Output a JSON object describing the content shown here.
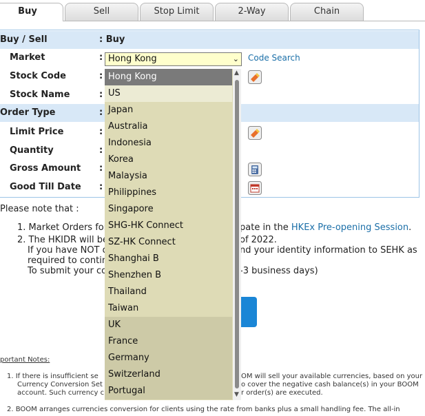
{
  "tabs": [
    {
      "label": "Buy",
      "active": true
    },
    {
      "label": "Sell",
      "active": false
    },
    {
      "label": "Stop Limit",
      "active": false
    },
    {
      "label": "2-Way",
      "active": false
    },
    {
      "label": "Chain",
      "active": false
    }
  ],
  "form": {
    "buy_sell_label": "Buy / Sell",
    "buy_sell_value": ": Buy",
    "market_label": "Market",
    "market_value": "Hong Kong",
    "code_search": "Code Search",
    "stock_code_label": "Stock Code",
    "stock_name_label": "Stock Name",
    "order_type_label": "Order Type",
    "limit_price_label": "Limit Price",
    "quantity_label": "Quantity",
    "gross_amount_label": "Gross Amount",
    "good_till_date_label": "Good Till Date",
    "colon": ":"
  },
  "notes": {
    "please_note": "Please note that :",
    "item1_start": "1. Market Orders for",
    "item1_end": "pate in the",
    "item1_link": "HKEx Pre-opening Session",
    "item1_tail": ".",
    "item2_start": "2. The HKIDR will be",
    "item2_end": "of 2022.",
    "item2_line2a": "If you have NOT d",
    "item2_line2b": "nd your identity information to SEHK as",
    "item2_line3": "required to continu",
    "item2_line4_link": "To submit your co",
    "item2_line4_end": "-3 business days)"
  },
  "important": {
    "title": "portant Notes:",
    "n1_a": "1. If there is insufficient se",
    "n1_b": "OM will sell your available currencies, based on your",
    "n1_link": "Currency Conversion Set",
    "n1_c": "o cover the negative cash balance(s) in your BOOM",
    "n1_d": "account. Such currency c",
    "n1_e": "r order(s) are executed.",
    "n2_a": "2. BOOM arranges currencies conversion for clients using the rate from banks plus a small handling fee. The all-in"
  },
  "market_options": [
    "Hong Kong",
    "US",
    "Japan",
    "Australia",
    "Indonesia",
    "Korea",
    "Malaysia",
    "Philippines",
    "Singapore",
    "SHG-HK Connect",
    "SZ-HK Connect",
    "Shanghai B",
    "Shenzhen B",
    "Thailand",
    "Taiwan",
    "UK",
    "France",
    "Germany",
    "Switzerland",
    "Portugal"
  ],
  "colors": {
    "header_bg": "#d8e8f7",
    "select_bg": "#ffffcc",
    "dropdown_bg": "#dedbb6",
    "link": "#1b6fa8",
    "button": "#1a86d6"
  }
}
